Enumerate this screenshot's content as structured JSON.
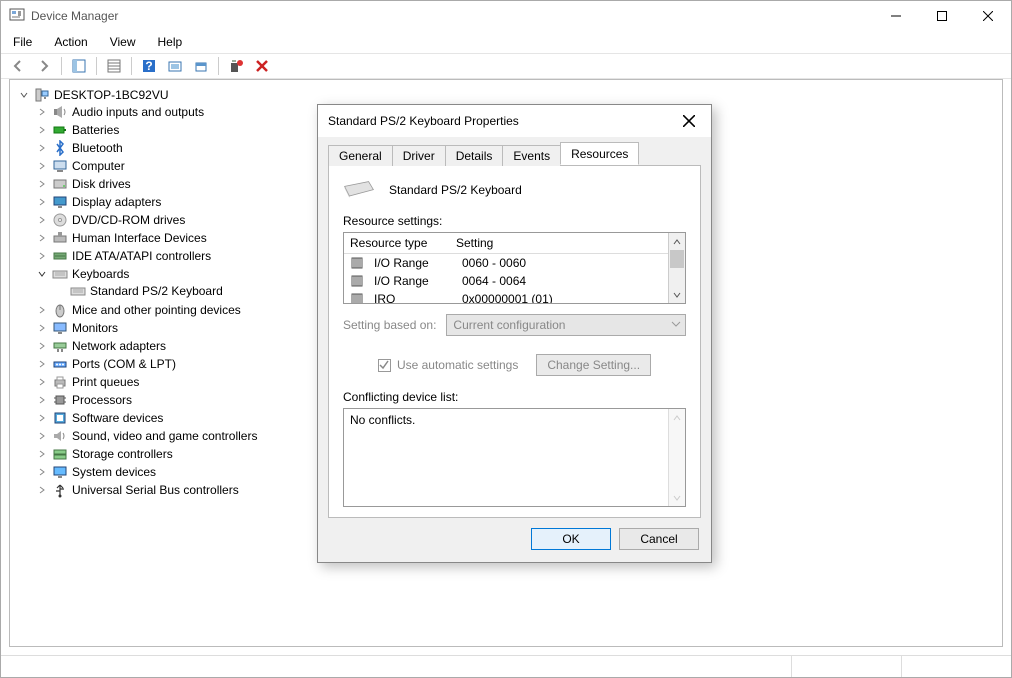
{
  "window": {
    "title": "Device Manager"
  },
  "menubar": [
    "File",
    "Action",
    "View",
    "Help"
  ],
  "tree": {
    "root": "DESKTOP-1BC92VU",
    "nodes": [
      {
        "label": "Audio inputs and outputs",
        "icon": "speaker"
      },
      {
        "label": "Batteries",
        "icon": "battery"
      },
      {
        "label": "Bluetooth",
        "icon": "bluetooth"
      },
      {
        "label": "Computer",
        "icon": "computer"
      },
      {
        "label": "Disk drives",
        "icon": "disk"
      },
      {
        "label": "Display adapters",
        "icon": "display"
      },
      {
        "label": "DVD/CD-ROM drives",
        "icon": "cd"
      },
      {
        "label": "Human Interface Devices",
        "icon": "hid"
      },
      {
        "label": "IDE ATA/ATAPI controllers",
        "icon": "ide"
      },
      {
        "label": "Keyboards",
        "icon": "keyboard",
        "expanded": true,
        "children": [
          {
            "label": "Standard PS/2 Keyboard",
            "icon": "keyboard"
          }
        ]
      },
      {
        "label": "Mice and other pointing devices",
        "icon": "mouse"
      },
      {
        "label": "Monitors",
        "icon": "monitor"
      },
      {
        "label": "Network adapters",
        "icon": "network"
      },
      {
        "label": "Ports (COM & LPT)",
        "icon": "port"
      },
      {
        "label": "Print queues",
        "icon": "print"
      },
      {
        "label": "Processors",
        "icon": "cpu"
      },
      {
        "label": "Software devices",
        "icon": "soft"
      },
      {
        "label": "Sound, video and game controllers",
        "icon": "sound"
      },
      {
        "label": "Storage controllers",
        "icon": "storage"
      },
      {
        "label": "System devices",
        "icon": "system"
      },
      {
        "label": "Universal Serial Bus controllers",
        "icon": "usb"
      }
    ]
  },
  "dialog": {
    "title": "Standard PS/2 Keyboard Properties",
    "tabs": [
      "General",
      "Driver",
      "Details",
      "Events",
      "Resources"
    ],
    "active_tab": 4,
    "device_name": "Standard PS/2 Keyboard",
    "resource_settings_label": "Resource settings:",
    "columns": {
      "type": "Resource type",
      "setting": "Setting"
    },
    "resources": [
      {
        "type": "I/O Range",
        "setting": "0060 - 0060"
      },
      {
        "type": "I/O Range",
        "setting": "0064 - 0064"
      },
      {
        "type": "IRQ",
        "setting": "0x00000001 (01)"
      }
    ],
    "setting_based_on_label": "Setting based on:",
    "setting_based_on_value": "Current configuration",
    "use_automatic_label": "Use automatic settings",
    "use_automatic_checked": true,
    "change_setting_label": "Change Setting...",
    "conflicting_label": "Conflicting device list:",
    "conflicting_value": "No conflicts.",
    "ok_label": "OK",
    "cancel_label": "Cancel"
  }
}
